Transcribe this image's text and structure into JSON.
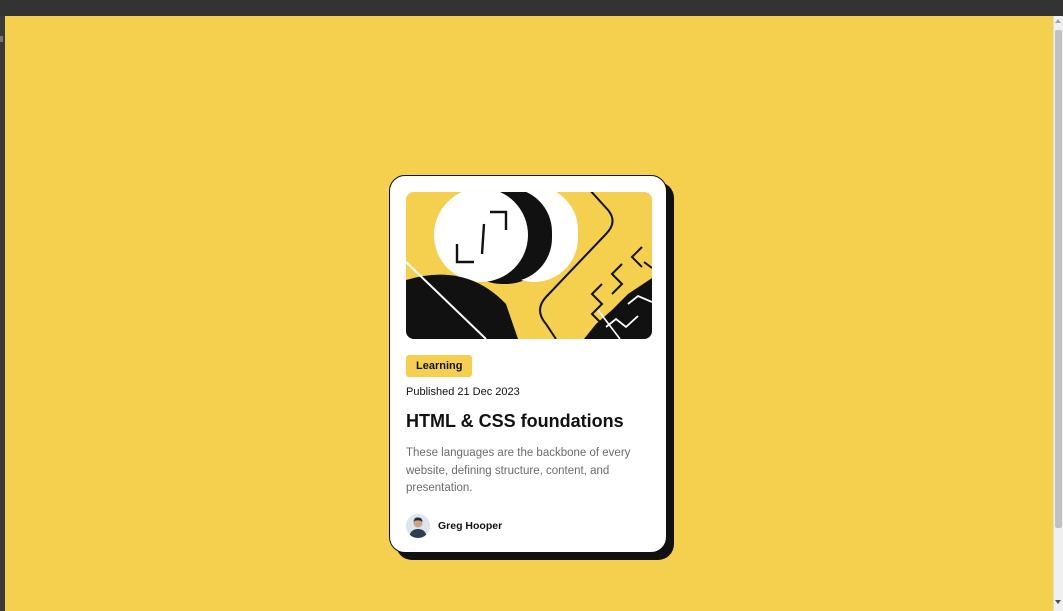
{
  "card": {
    "tag": "Learning",
    "published": "Published 21 Dec 2023",
    "title": "HTML & CSS foundations",
    "description": "These languages are the backbone of every website, defining structure, content, and presentation.",
    "author": "Greg Hooper"
  },
  "colors": {
    "background": "#f4d04e",
    "card": "#ffffff",
    "shadow": "#111111",
    "tag_bg": "#f4d04e",
    "text_muted": "#6b6b6b"
  },
  "icons": {
    "card_illustration": "abstract-illustration",
    "avatar": "avatar"
  }
}
